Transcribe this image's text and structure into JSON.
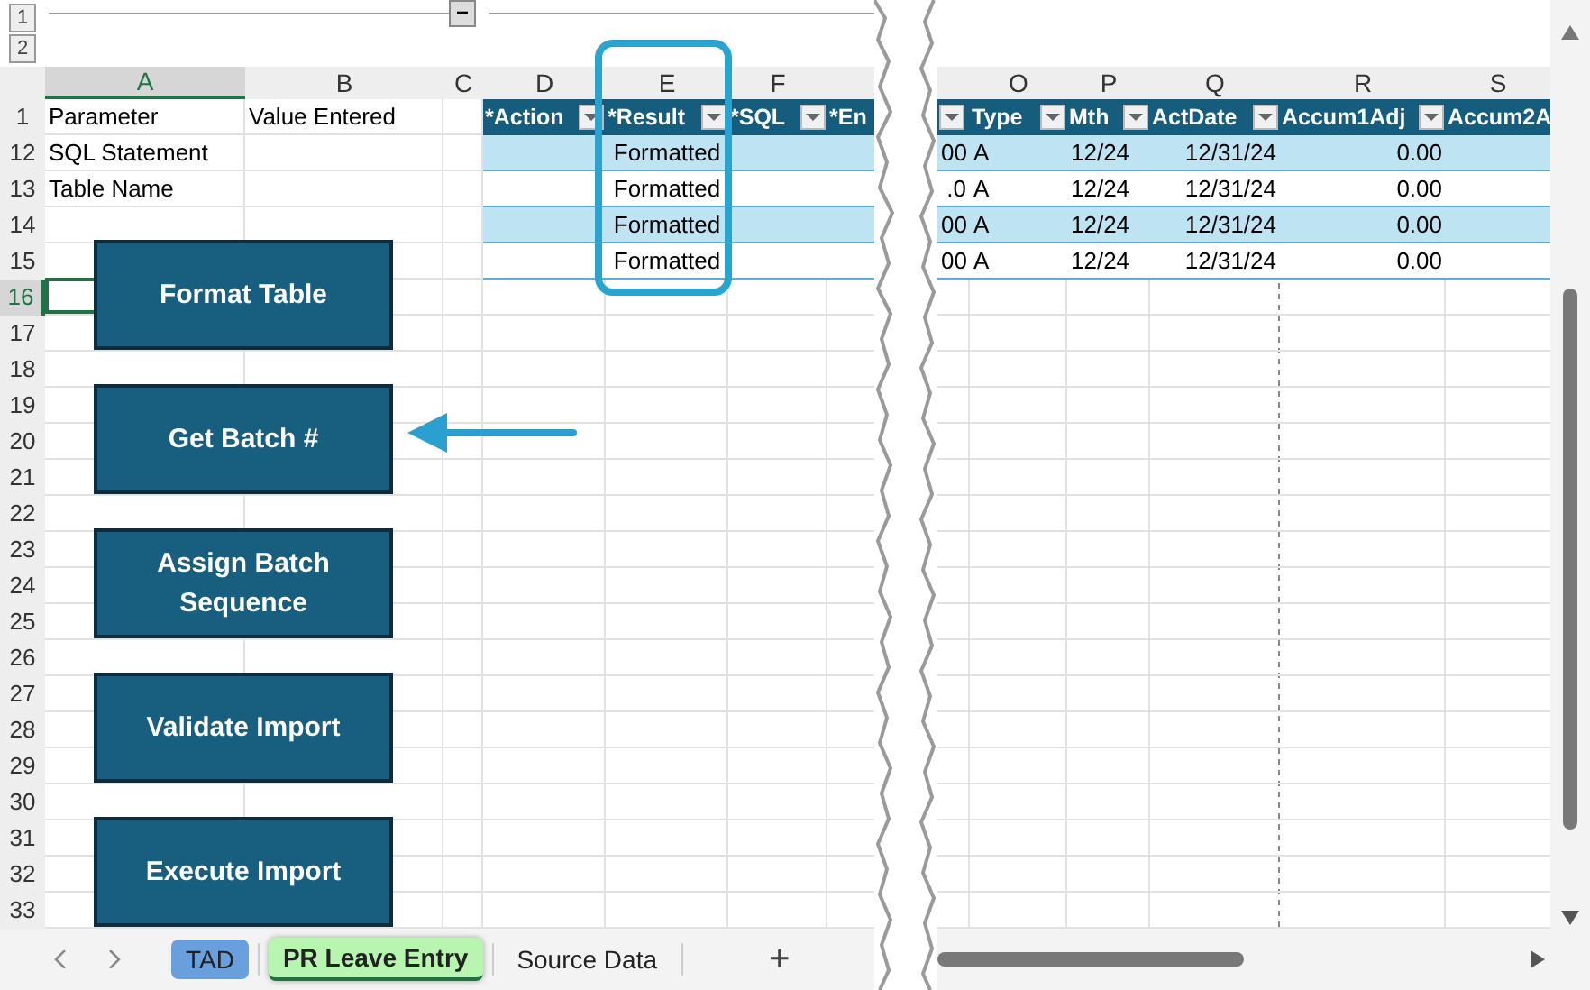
{
  "outline": {
    "levels": [
      "1",
      "2"
    ],
    "collapse_button": "−"
  },
  "columns_left": [
    {
      "label": "A",
      "selected": true
    },
    {
      "label": "B",
      "selected": false
    },
    {
      "label": "C",
      "selected": false
    },
    {
      "label": "D",
      "selected": false
    },
    {
      "label": "E",
      "selected": false
    },
    {
      "label": "F",
      "selected": false
    }
  ],
  "columns_right": [
    {
      "label": "O",
      "selected": false
    },
    {
      "label": "P",
      "selected": false
    },
    {
      "label": "Q",
      "selected": false
    },
    {
      "label": "R",
      "selected": false
    },
    {
      "label": "S",
      "selected": false
    }
  ],
  "rows": [
    {
      "number": "1",
      "selected": false
    },
    {
      "number": "12",
      "selected": false
    },
    {
      "number": "13",
      "selected": false
    },
    {
      "number": "14",
      "selected": false
    },
    {
      "number": "15",
      "selected": false
    },
    {
      "number": "16",
      "selected": true
    },
    {
      "number": "17",
      "selected": false
    },
    {
      "number": "18",
      "selected": false
    },
    {
      "number": "19",
      "selected": false
    },
    {
      "number": "20",
      "selected": false
    },
    {
      "number": "21",
      "selected": false
    },
    {
      "number": "22",
      "selected": false
    },
    {
      "number": "23",
      "selected": false
    },
    {
      "number": "24",
      "selected": false
    },
    {
      "number": "25",
      "selected": false
    },
    {
      "number": "26",
      "selected": false
    },
    {
      "number": "27",
      "selected": false
    },
    {
      "number": "28",
      "selected": false
    },
    {
      "number": "29",
      "selected": false
    },
    {
      "number": "30",
      "selected": false
    },
    {
      "number": "31",
      "selected": false
    },
    {
      "number": "32",
      "selected": false
    },
    {
      "number": "33",
      "selected": false
    }
  ],
  "parameters": [
    {
      "name": "Parameter",
      "value": "Value Entered"
    },
    {
      "name": "SQL Statement"
    },
    {
      "name": "Table Name"
    }
  ],
  "table": {
    "headers_left": [
      "*Action",
      "*Result",
      "*SQL",
      "*En"
    ],
    "headers_right": [
      "Type",
      "Mth",
      "ActDate",
      "Accum1Adj",
      "Accum2A"
    ],
    "rows": [
      {
        "result": "Formatted",
        "column_n": "00",
        "type": "A",
        "mth": "12/24",
        "act_date": "12/31/24",
        "accum1adj": "0.00"
      },
      {
        "result": "Formatted",
        "column_n": ".0",
        "type": "A",
        "mth": "12/24",
        "act_date": "12/31/24",
        "accum1adj": "0.00"
      },
      {
        "result": "Formatted",
        "column_n": "00",
        "type": "A",
        "mth": "12/24",
        "act_date": "12/31/24",
        "accum1adj": "0.00"
      },
      {
        "result": "Formatted",
        "column_n": "00",
        "type": "A",
        "mth": "12/24",
        "act_date": "12/31/24",
        "accum1adj": "0.00"
      }
    ]
  },
  "buttons": [
    "Format Table",
    "Get Batch #",
    "Assign Batch Sequence",
    "Validate Import",
    "Execute Import"
  ],
  "sheet_tabs": [
    {
      "label": "TAD",
      "selected": false,
      "color": "#6a9fde"
    },
    {
      "label": "PR Leave Entry",
      "selected": true,
      "color": "#b8f5b0"
    },
    {
      "label": "Source Data",
      "selected": false
    }
  ],
  "add_sheet": "+"
}
